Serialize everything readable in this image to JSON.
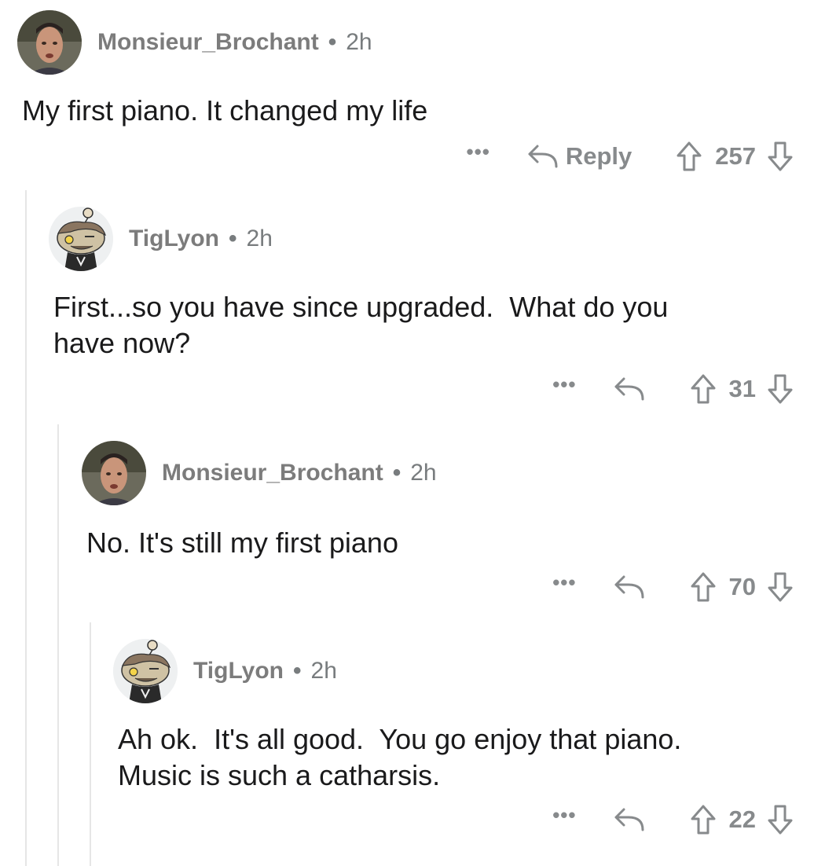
{
  "colors": {
    "meta_text": "#787c7e",
    "body_text": "#1a1a1b",
    "thread_line": "#e6e6e6",
    "action_icon": "#878a8c"
  },
  "comments": [
    {
      "username": "Monsieur_Brochant",
      "time": "2h",
      "body": "My first piano. It changed my life",
      "reply_label": "Reply",
      "score": "257",
      "avatar_icon": "man-face-avatar"
    },
    {
      "username": "TigLyon",
      "time": "2h",
      "body": "First...so you have since upgraded.  What do you\nhave now?",
      "score": "31",
      "avatar_icon": "snoo-avatar"
    },
    {
      "username": "Monsieur_Brochant",
      "time": "2h",
      "body": "No. It's still my first piano",
      "score": "70",
      "avatar_icon": "man-face-avatar"
    },
    {
      "username": "TigLyon",
      "time": "2h",
      "body": "Ah ok.  It's all good.  You go enjoy that piano.\nMusic is such a catharsis.",
      "score": "22",
      "avatar_icon": "snoo-avatar"
    }
  ],
  "separator": "•",
  "more_glyph": "•••",
  "icons": [
    "more-icon",
    "reply-icon",
    "upvote-icon",
    "downvote-icon"
  ]
}
